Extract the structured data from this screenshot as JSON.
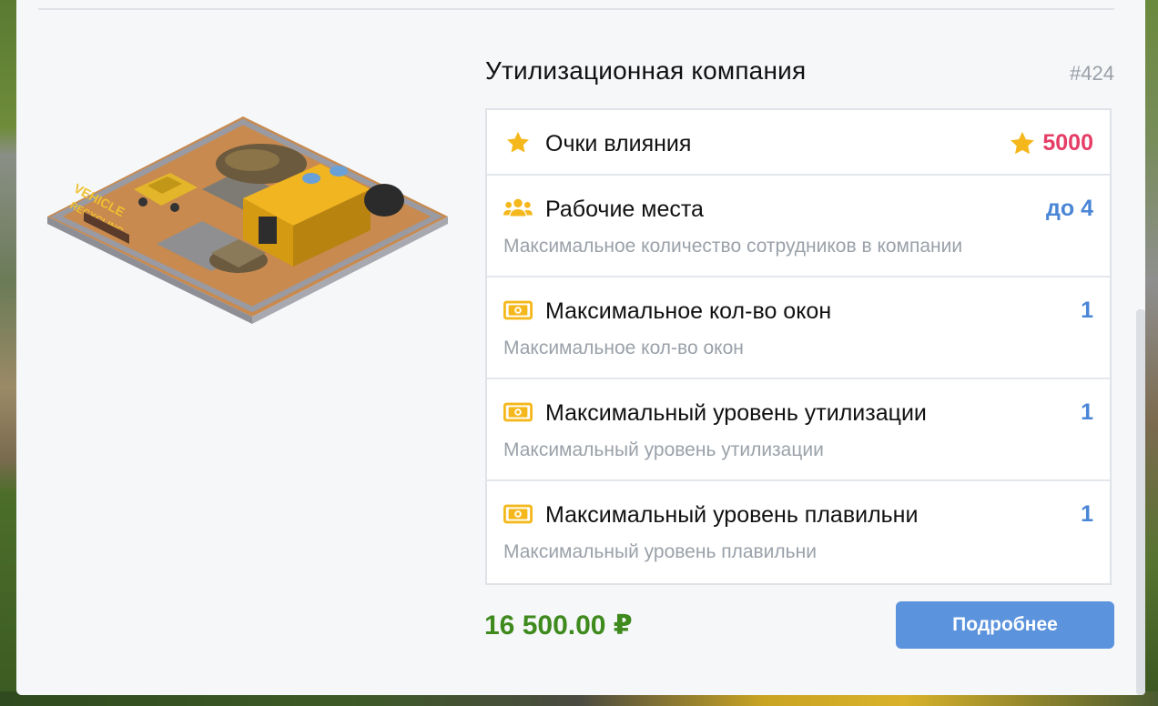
{
  "company": {
    "title": "Утилизационная компания",
    "id_label": "#424",
    "image_sign": "VEHICLE RECYCLING"
  },
  "stats": [
    {
      "icon": "star-icon",
      "label": "Очки влияния",
      "value": "5000",
      "value_color": "#e53d66",
      "value_icon": "star-icon"
    },
    {
      "icon": "users-icon",
      "label": "Рабочие места",
      "value": "до 4",
      "description": "Максимальное количество сотрудников в компании"
    },
    {
      "icon": "banknote-icon",
      "label": "Максимальное кол-во окон",
      "value": "1",
      "description": "Максимальное кол-во окон"
    },
    {
      "icon": "banknote-icon",
      "label": "Максимальный уровень утилизации",
      "value": "1",
      "description": "Максимальный уровень утилизации"
    },
    {
      "icon": "banknote-icon",
      "label": "Максимальный уровень плавильни",
      "value": "1",
      "description": "Максимальный уровень плавильни"
    }
  ],
  "price": "16 500.00 ₽",
  "details_button": "Подробнее",
  "colors": {
    "accent": "#5b93dc",
    "price": "#3f8a1d",
    "icon": "#f5b81c",
    "value_blue": "#4a86d6",
    "value_red": "#e53d66"
  }
}
